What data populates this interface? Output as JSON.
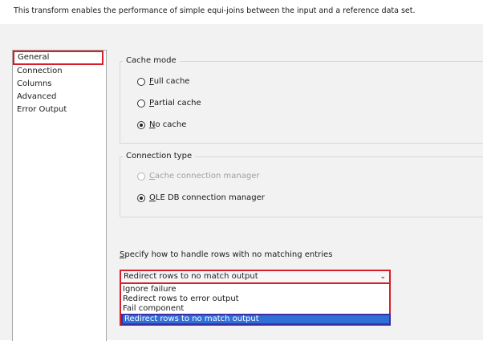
{
  "description": "This transform enables the performance of simple equi-joins between the input and a reference data set.",
  "nav": {
    "items": [
      "General",
      "Connection",
      "Columns",
      "Advanced",
      "Error Output"
    ],
    "selected": "General"
  },
  "cache_mode": {
    "title": "Cache mode",
    "options": [
      {
        "label": "Full cache",
        "underline": "F",
        "rest": "ull cache",
        "checked": false
      },
      {
        "label": "Partial cache",
        "underline": "P",
        "rest": "artial cache",
        "checked": false
      },
      {
        "label": "No cache",
        "underline": "N",
        "rest": "o cache",
        "checked": true
      }
    ]
  },
  "connection_type": {
    "title": "Connection type",
    "options": [
      {
        "label": "Cache connection manager",
        "underline": "C",
        "rest": "ache connection manager",
        "checked": false,
        "disabled": true
      },
      {
        "label": "OLE DB connection manager",
        "underline": "O",
        "rest": "LE DB connection manager",
        "checked": true,
        "disabled": false
      }
    ]
  },
  "no_match": {
    "label": "Specify how to handle rows with no matching entries",
    "label_underline": "S",
    "label_rest": "pecify how to handle rows with no matching entries",
    "selected": "Redirect rows to no match output",
    "options": [
      "Ignore failure",
      "Redirect rows to error output",
      "Fail component",
      "Redirect rows to no match output"
    ]
  },
  "colors": {
    "highlight_red": "#d4202a",
    "selection_blue": "#2f6fd6"
  }
}
